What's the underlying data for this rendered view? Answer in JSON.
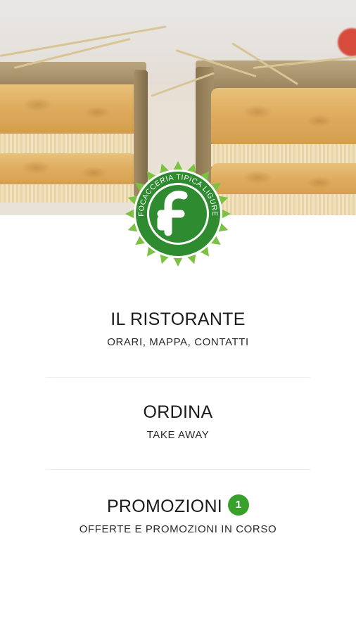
{
  "logo": {
    "text": "FOCACCERIA TIPICA LIGURE",
    "letter": "f",
    "colors": {
      "outer": "#7cc242",
      "ring": "#2f8b2f",
      "inner": "#2f8b2f",
      "letter": "#ffffff"
    }
  },
  "menu": [
    {
      "title": "IL RISTORANTE",
      "subtitle": "ORARI, MAPPA, CONTATTI"
    },
    {
      "title": "ORDINA",
      "subtitle": "TAKE AWAY"
    },
    {
      "title": "PROMOZIONI",
      "subtitle": "OFFERTE E PROMOZIONI IN CORSO",
      "badge": "1"
    }
  ],
  "colors": {
    "badge": "#38a12c",
    "divider": "#f1ede4"
  }
}
